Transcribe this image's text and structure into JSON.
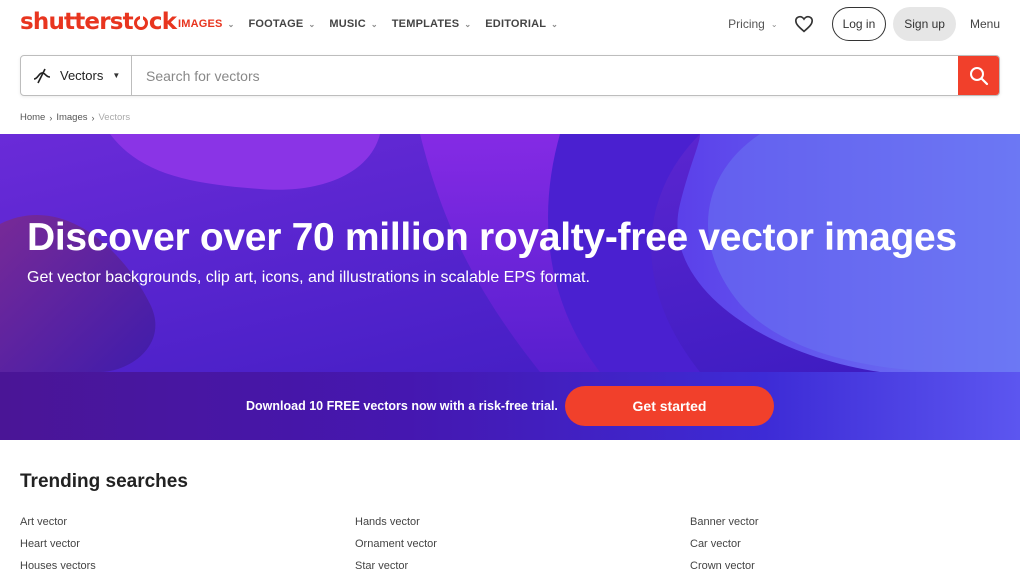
{
  "brand": {
    "logo_before": "shutterst",
    "logo_after": "ck",
    "color": "#e8351f"
  },
  "nav": {
    "items": [
      {
        "label": "IMAGES",
        "active": true
      },
      {
        "label": "FOOTAGE",
        "active": false
      },
      {
        "label": "MUSIC",
        "active": false
      },
      {
        "label": "TEMPLATES",
        "active": false
      },
      {
        "label": "EDITORIAL",
        "active": false
      }
    ],
    "pricing": "Pricing",
    "login": "Log in",
    "signup": "Sign up",
    "menu": "Menu"
  },
  "search": {
    "type_label": "Vectors",
    "placeholder": "Search for vectors",
    "value": ""
  },
  "breadcrumb": [
    "Home",
    "Images",
    "Vectors"
  ],
  "hero": {
    "title": "Discover over 70 million royalty-free vector images",
    "subtitle": "Get vector backgrounds, clip art, icons, and illustrations in scalable EPS format."
  },
  "promo": {
    "text": "Download 10 FREE vectors now with a risk-free trial.",
    "button": "Get started",
    "button_color": "#f1402b"
  },
  "trending": {
    "title": "Trending searches",
    "columns": [
      [
        "Art vector",
        "Heart vector",
        "Houses vectors"
      ],
      [
        "Hands vector",
        "Ornament vector",
        "Star vector"
      ],
      [
        "Banner vector",
        "Car vector",
        "Crown vector"
      ]
    ]
  }
}
